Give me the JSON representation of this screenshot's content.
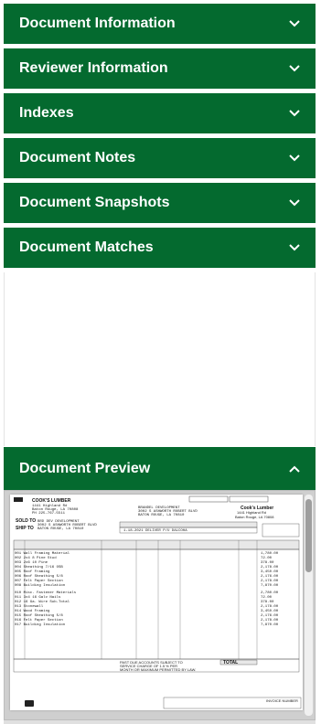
{
  "accordion": {
    "sections": [
      {
        "label": "Document Information"
      },
      {
        "label": "Reviewer Information"
      },
      {
        "label": "Indexes"
      },
      {
        "label": "Document Notes"
      },
      {
        "label": "Document Snapshots"
      },
      {
        "label": "Document Matches"
      }
    ],
    "preview": {
      "label": "Document Preview"
    }
  },
  "invoice": {
    "brand": "COOK'S LUMBER",
    "sold_to_label": "SOLD TO",
    "ship_to_label": "SHIP TO",
    "logo_name": "Cook's Lumber",
    "total_label": "TOTAL",
    "footer_invoice_label": "INVOICE NUMBER"
  },
  "colors": {
    "header_green": "#046a2f"
  }
}
